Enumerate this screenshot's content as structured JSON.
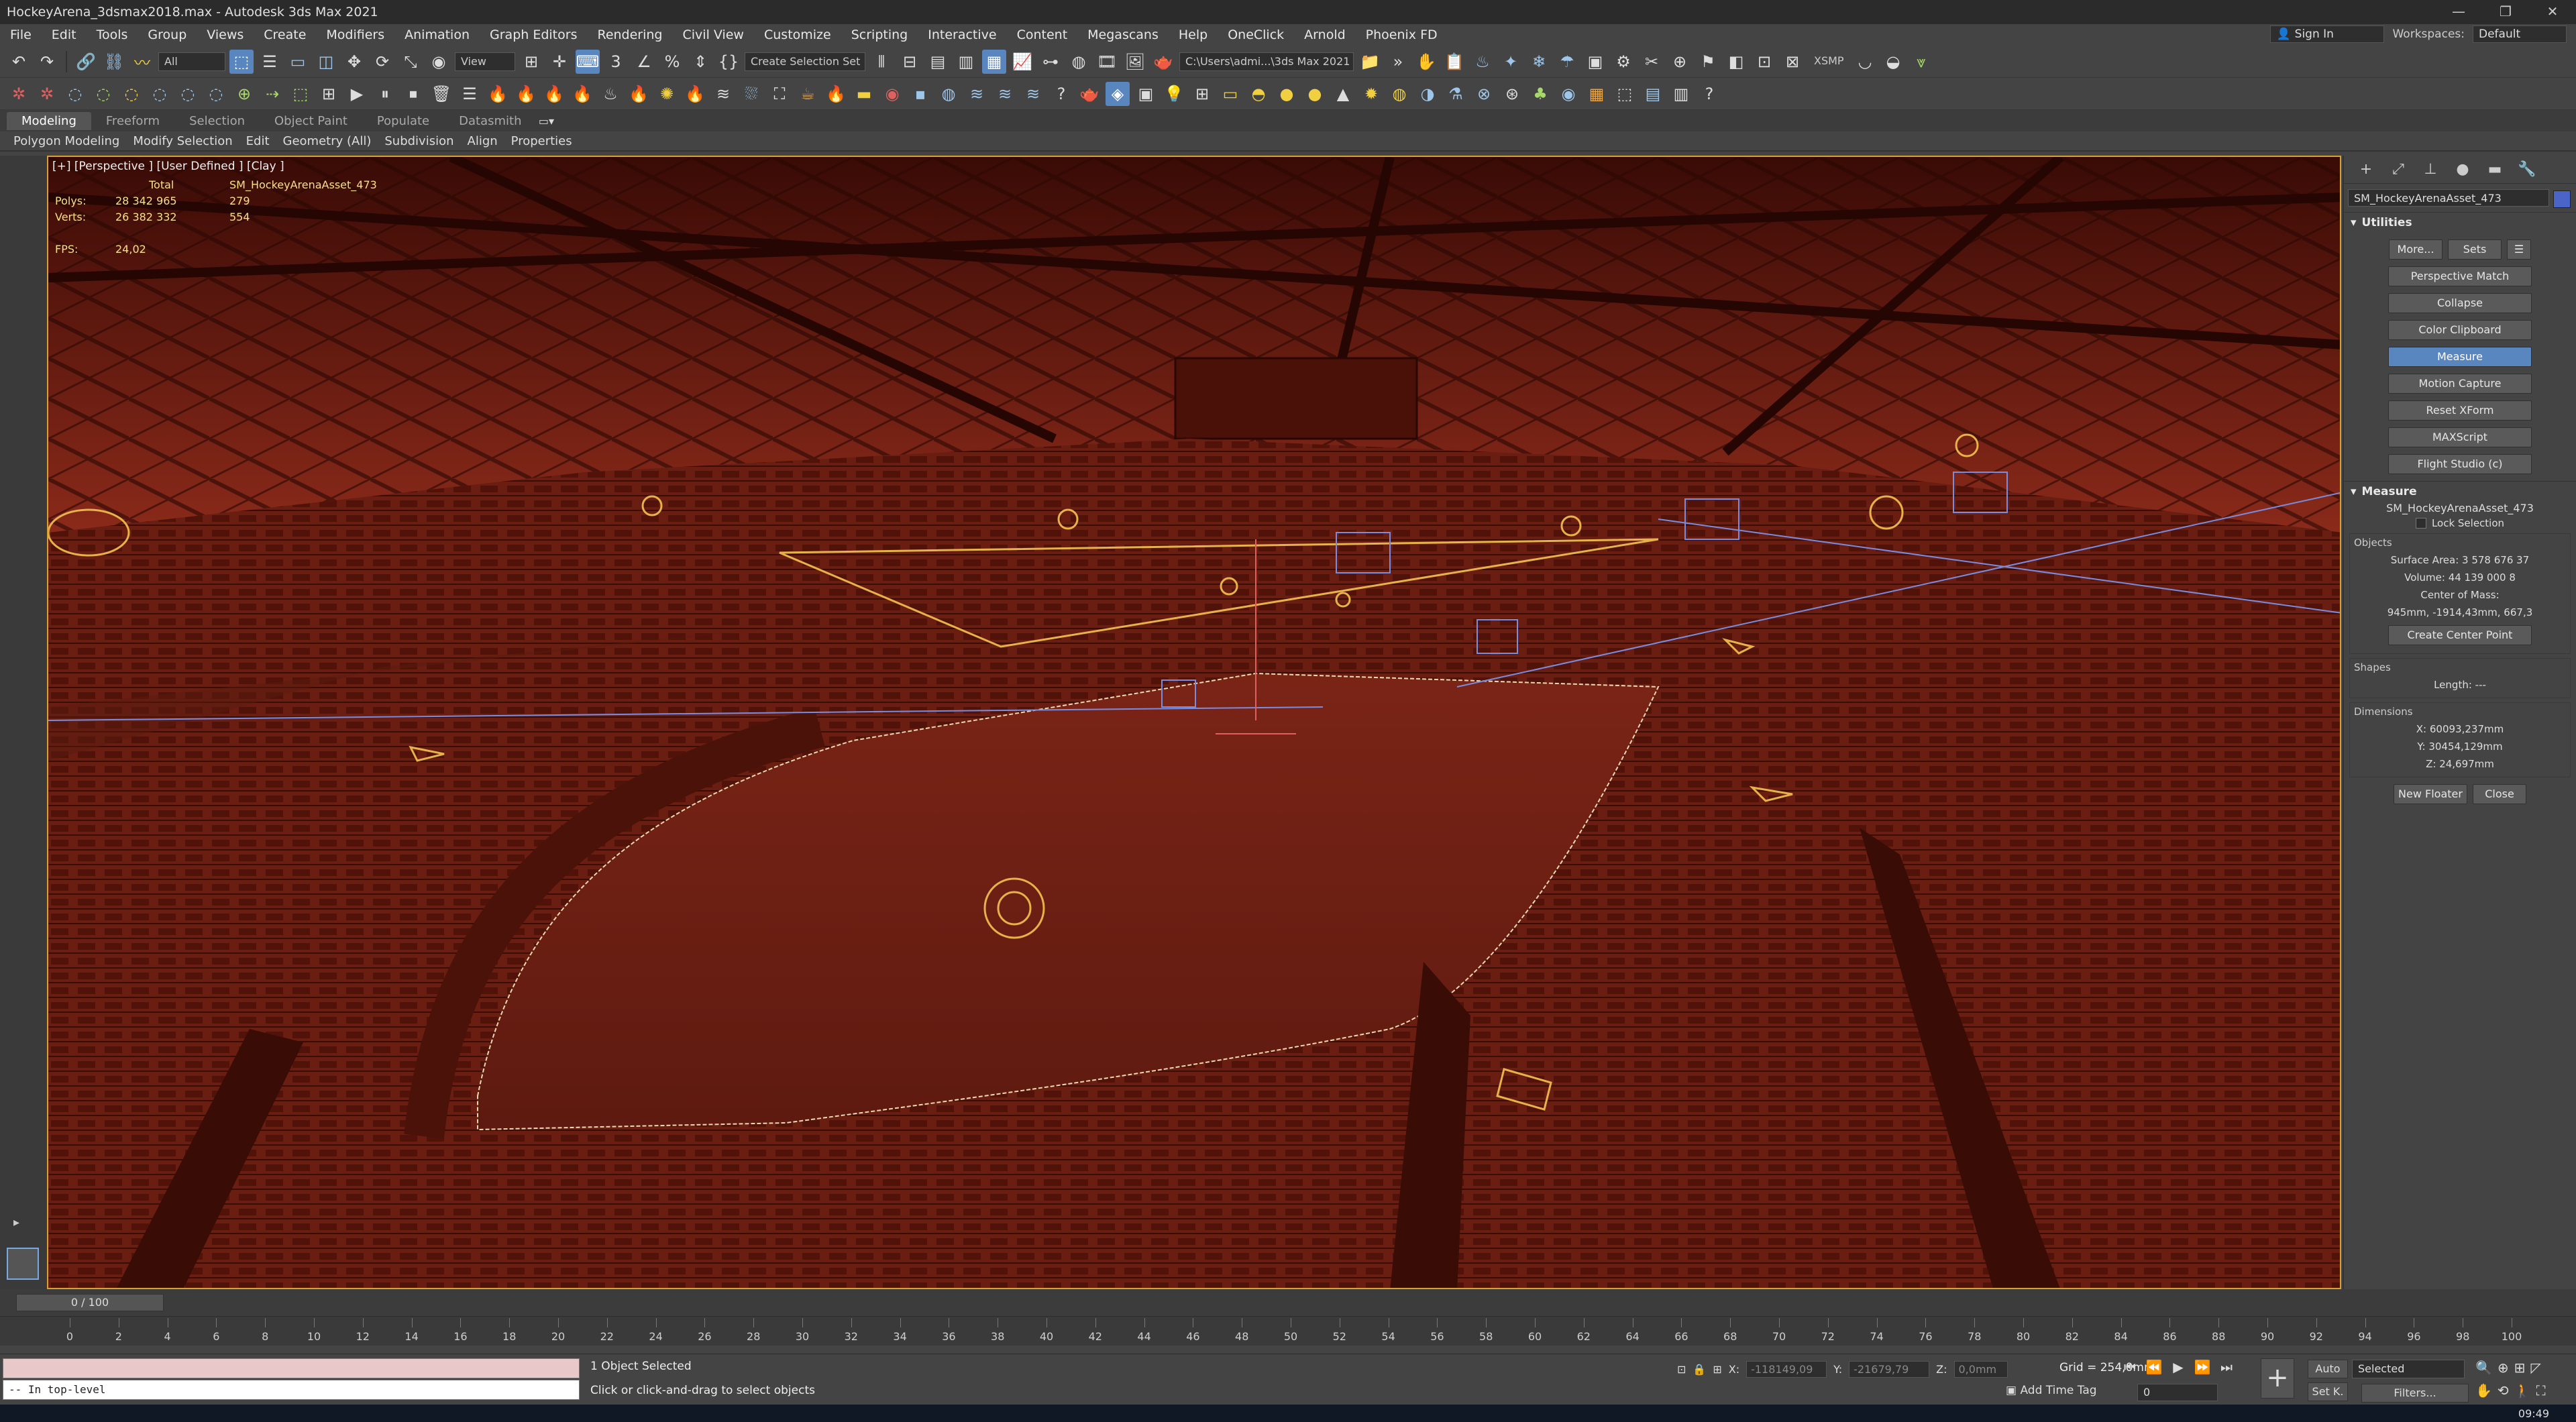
{
  "window": {
    "title": "HockeyArena_3dsmax2018.max - Autodesk 3ds Max 2021",
    "controls": [
      "—",
      "❐",
      "✕"
    ]
  },
  "menu": [
    "File",
    "Edit",
    "Tools",
    "Group",
    "Views",
    "Create",
    "Modifiers",
    "Animation",
    "Graph Editors",
    "Rendering",
    "Civil View",
    "Customize",
    "Scripting",
    "Interactive",
    "Content",
    "Megascans",
    "Help",
    "OneClick",
    "Arnold",
    "Phoenix FD"
  ],
  "account": {
    "sign_in": "Sign In",
    "workspaces_label": "Workspaces:",
    "workspace": "Default"
  },
  "toolbar": {
    "selection_filter": "All",
    "ref_coord": "View",
    "named_selection": "Create Selection Set",
    "project_path": "C:\\Users\\admi...\\3ds Max 2021",
    "xsmp": "XSMP"
  },
  "ribbon": {
    "tabs": [
      "Modeling",
      "Freeform",
      "Selection",
      "Object Paint",
      "Populate",
      "Datasmith"
    ],
    "active_tab": "Modeling",
    "sub": [
      "Polygon Modeling",
      "Modify Selection",
      "Edit",
      "Geometry (All)",
      "Subdivision",
      "Align",
      "Properties"
    ]
  },
  "viewport": {
    "label": "[+] [Perspective ] [User Defined ] [Clay ]",
    "stats": {
      "header_total": "Total",
      "header_obj": "SM_HockeyArenaAsset_473",
      "polys_label": "Polys:",
      "polys_total": "28 342 965",
      "polys_obj": "279",
      "verts_label": "Verts:",
      "verts_total": "26 382 332",
      "verts_obj": "554",
      "fps_label": "FPS:",
      "fps": "24,02"
    }
  },
  "command_panel": {
    "object_name": "SM_HockeyArenaAsset_473",
    "object_color": "#4a64c8",
    "utilities": {
      "title": "Utilities",
      "more": "More...",
      "sets": "Sets",
      "buttons": [
        "Perspective Match",
        "Collapse",
        "Color Clipboard",
        "Measure",
        "Motion Capture",
        "Reset XForm",
        "MAXScript",
        "Flight Studio (c)"
      ],
      "active": "Measure"
    },
    "measure": {
      "title": "Measure",
      "object": "SM_HockeyArenaAsset_473",
      "lock_selection": "Lock Selection",
      "objects_label": "Objects",
      "surface_area": "Surface Area: 3 578 676 37",
      "volume": "Volume: 44 139 000 8",
      "center_label": "Center of Mass:",
      "center": "945mm, -1914,43mm, 667,3",
      "create_center": "Create Center Point",
      "shapes_label": "Shapes",
      "length": "Length: ---",
      "dimensions_label": "Dimensions",
      "x": "X:  60093,237mm",
      "y": "Y:  30454,129mm",
      "z": "Z:  24,697mm",
      "new_floater": "New Floater",
      "close": "Close"
    }
  },
  "timeline": {
    "slider": "0 / 100",
    "ticks": [
      "0",
      "2",
      "4",
      "6",
      "8",
      "10",
      "12",
      "14",
      "16",
      "18",
      "20",
      "22",
      "24",
      "26",
      "28",
      "30",
      "32",
      "34",
      "36",
      "38",
      "40",
      "42",
      "44",
      "46",
      "48",
      "50",
      "52",
      "54",
      "56",
      "58",
      "60",
      "62",
      "64",
      "66",
      "68",
      "70",
      "72",
      "74",
      "76",
      "78",
      "80",
      "82",
      "84",
      "86",
      "88",
      "90",
      "92",
      "94",
      "96",
      "98",
      "100"
    ]
  },
  "status": {
    "maxscript_line": "-- In top-level",
    "selected": "1 Object Selected",
    "prompt": "Click or click-and-drag to select objects",
    "x_label": "X:",
    "x": "-118149,09",
    "y_label": "Y:",
    "y": "-21679,79",
    "z_label": "Z:",
    "z": "0,0mm",
    "grid": "Grid = 254,0mm",
    "add_time_tag": "Add Time Tag",
    "auto": "Auto",
    "set_k": "Set K.",
    "selected_dd": "Selected",
    "filters": "Filters...",
    "frame": "0",
    "clock": "09:49"
  }
}
